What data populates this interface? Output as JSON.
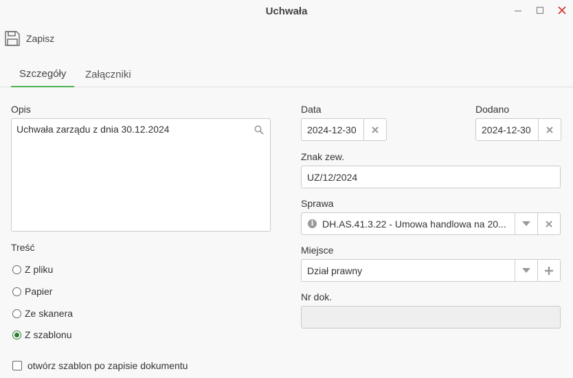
{
  "window": {
    "title": "Uchwała"
  },
  "toolbar": {
    "save_label": "Zapisz"
  },
  "tabs": [
    {
      "label": "Szczegóły",
      "active": true
    },
    {
      "label": "Załączniki",
      "active": false
    }
  ],
  "form": {
    "opis": {
      "label": "Opis",
      "value": "Uchwała zarządu z dnia 30.12.2024"
    },
    "data": {
      "label": "Data",
      "value": "2024-12-30"
    },
    "dodano": {
      "label": "Dodano",
      "value": "2024-12-30"
    },
    "znak_zew": {
      "label": "Znak zew.",
      "value": "UZ/12/2024"
    },
    "sprawa": {
      "label": "Sprawa",
      "value": "DH.AS.41.3.22 - Umowa handlowa na 20..."
    },
    "miejsce": {
      "label": "Miejsce",
      "value": "Dział prawny"
    },
    "nr_dok": {
      "label": "Nr dok.",
      "value": ""
    },
    "tresc": {
      "label": "Treść",
      "options": [
        {
          "label": "Z pliku",
          "selected": false
        },
        {
          "label": "Papier",
          "selected": false
        },
        {
          "label": "Ze skanera",
          "selected": false
        },
        {
          "label": "Z szablonu",
          "selected": true
        }
      ]
    },
    "open_template": {
      "label": "otwórz szablon po zapisie dokumentu",
      "checked": false
    }
  },
  "colors": {
    "accent": "#4caf50",
    "close": "#d32f2f",
    "radio_selected": "#2e7d32"
  }
}
